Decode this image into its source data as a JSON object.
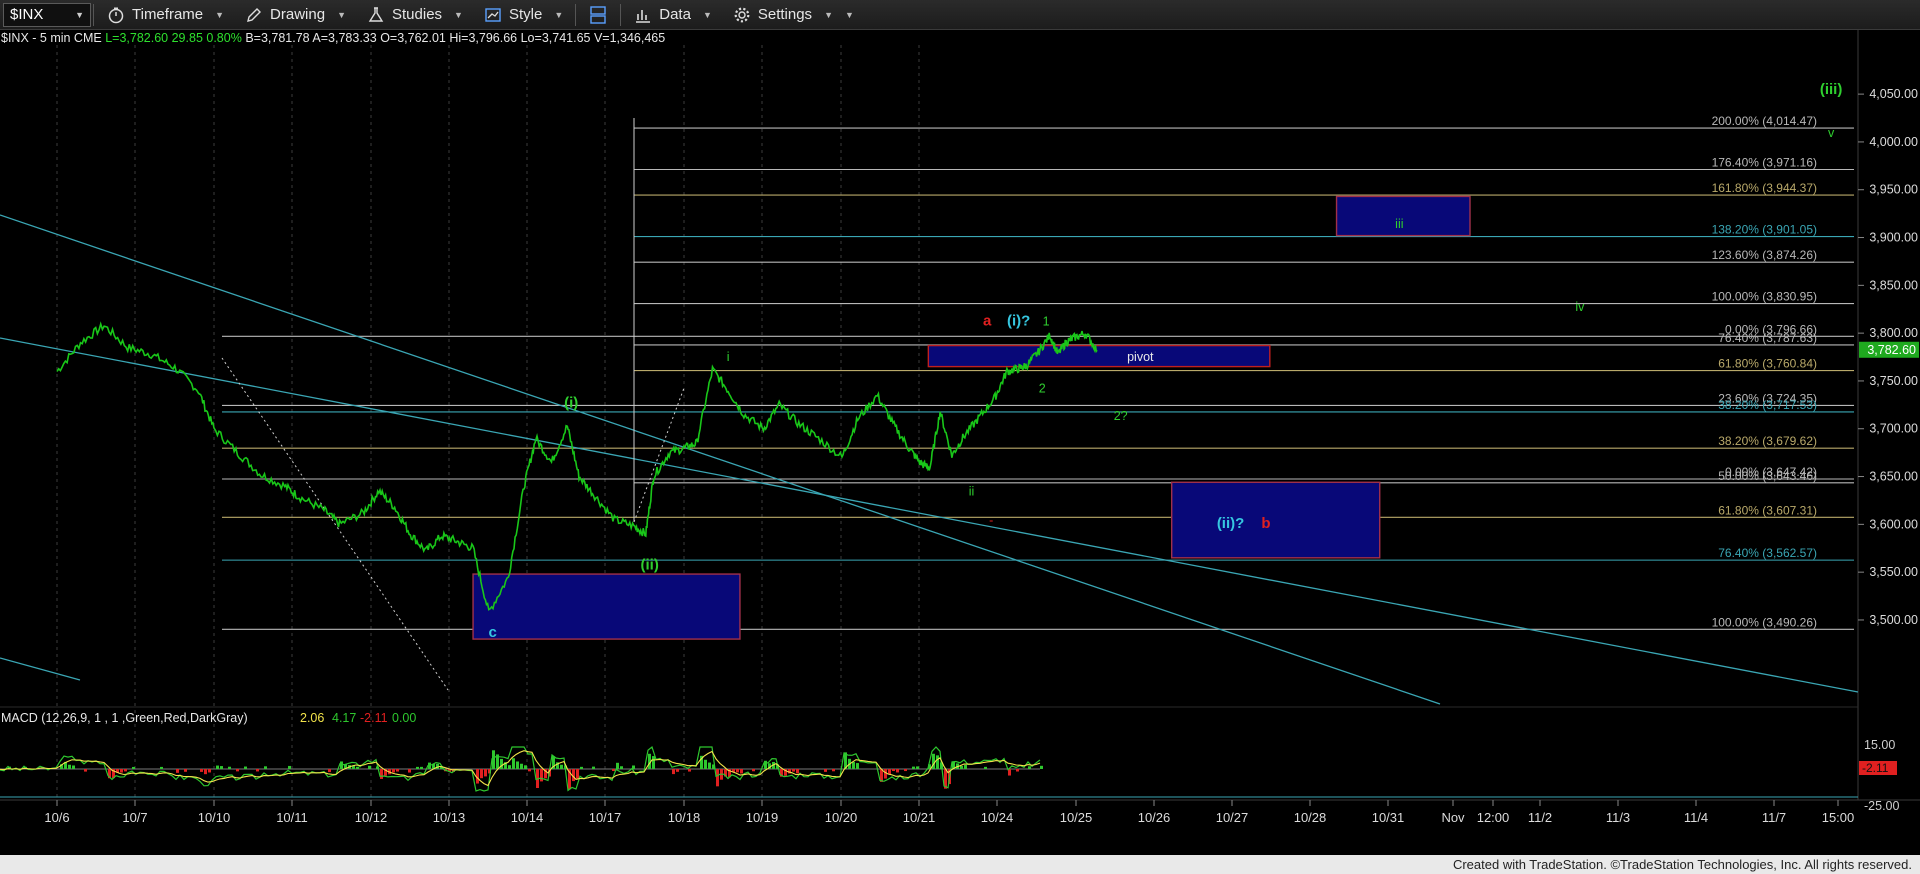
{
  "toolbar": {
    "symbol": "$INX",
    "items": [
      {
        "label": "Timeframe",
        "icon": "stopwatch-icon"
      },
      {
        "label": "Drawing",
        "icon": "pencil-icon"
      },
      {
        "label": "Studies",
        "icon": "flask-icon"
      },
      {
        "label": "Style",
        "icon": "chart-style-icon"
      },
      {
        "label": "",
        "icon": "layout-icon"
      },
      {
        "label": "Data",
        "icon": "bar-chart-icon"
      },
      {
        "label": "Settings",
        "icon": "gear-icon"
      }
    ]
  },
  "info": {
    "name": "$INX - 5 min  CME",
    "last": "L=3,782.60",
    "chg": "29.85",
    "pct": "0.80%",
    "bid": "B=3,781.78",
    "ask": "A=3,783.33",
    "open": "O=3,762.01",
    "high": "Hi=3,796.66",
    "low": "Lo=3,741.65",
    "vol": "V=1,346,465"
  },
  "macd": {
    "label": "MACD (12,26,9, 1 , 1 ,Green,Red,DarkGray)",
    "v1": "2.06",
    "v2": "4.17",
    "v3": "-2.11",
    "v4": "0.00",
    "axis": [
      "15.00",
      "-25.00"
    ],
    "current": "-2.11"
  },
  "footer": "Created with TradeStation. ©TradeStation Technologies, Inc. All rights reserved.",
  "colors": {
    "price": "#19c719",
    "fib": "#b8b8b8",
    "channel": "#3aa6b4",
    "box_fill": "#080878",
    "box_border": "#a0304a",
    "pivot_border": "#c02020",
    "label_green": "#2fcf2f",
    "label_cyan": "#36c7e0",
    "label_red": "#e02020",
    "price_tag": "#1faa1f"
  },
  "chart_data": {
    "type": "line",
    "title": "",
    "xlabel": "",
    "ylabel": "",
    "ylim": [
      3410,
      4070
    ],
    "y_ticks": [
      3500,
      3550,
      3600,
      3650,
      3700,
      3750,
      3800,
      3850,
      3900,
      3950,
      4000,
      4050
    ],
    "y_tick_labels": [
      "3,500.00",
      "3,550.00",
      "3,600.00",
      "3,650.00",
      "3,700.00",
      "3,750.00",
      "3,800.00",
      "3,850.00",
      "3,900.00",
      "3,950.00",
      "4,000.00",
      "4,050.00"
    ],
    "x_ticks": [
      "10/6",
      "10/7",
      "10/10",
      "10/11",
      "10/12",
      "10/13",
      "10/14",
      "10/17",
      "10/18",
      "10/19",
      "10/20",
      "10/21",
      "10/24",
      "10/25",
      "10/26",
      "10/27",
      "10/28",
      "10/31",
      "Nov",
      "12:00",
      "11/2",
      "11/3",
      "11/4",
      "11/7",
      "15:00"
    ],
    "current_price_label": "3,782.60",
    "current_price": 3782.6,
    "series": [
      {
        "points": [
          [
            0,
            3760
          ],
          [
            0.3,
            3790
          ],
          [
            0.6,
            3808
          ],
          [
            0.9,
            3785
          ],
          [
            1.2,
            3778
          ],
          [
            1.5,
            3764
          ],
          [
            1.8,
            3740
          ],
          [
            2.0,
            3700
          ],
          [
            2.3,
            3675
          ],
          [
            2.6,
            3652
          ],
          [
            2.9,
            3640
          ],
          [
            3.1,
            3628
          ],
          [
            3.4,
            3615
          ],
          [
            3.6,
            3600
          ],
          [
            3.9,
            3612
          ],
          [
            4.1,
            3635
          ],
          [
            4.3,
            3618
          ],
          [
            4.5,
            3590
          ],
          [
            4.7,
            3572
          ],
          [
            4.9,
            3588
          ],
          [
            5.1,
            3582
          ],
          [
            5.3,
            3575
          ],
          [
            5.5,
            3508
          ],
          [
            5.75,
            3545
          ],
          [
            5.95,
            3640
          ],
          [
            6.1,
            3690
          ],
          [
            6.3,
            3665
          ],
          [
            6.5,
            3703
          ],
          [
            6.65,
            3650
          ],
          [
            6.85,
            3630
          ],
          [
            7.1,
            3605
          ],
          [
            7.35,
            3598
          ],
          [
            7.5,
            3590
          ],
          [
            7.6,
            3650
          ],
          [
            7.8,
            3675
          ],
          [
            8.0,
            3680
          ],
          [
            8.15,
            3685
          ],
          [
            8.35,
            3762
          ],
          [
            8.55,
            3740
          ],
          [
            8.75,
            3715
          ],
          [
            9.0,
            3700
          ],
          [
            9.2,
            3725
          ],
          [
            9.45,
            3705
          ],
          [
            9.7,
            3690
          ],
          [
            10.0,
            3670
          ],
          [
            10.2,
            3710
          ],
          [
            10.45,
            3735
          ],
          [
            10.65,
            3705
          ],
          [
            10.85,
            3680
          ],
          [
            11.0,
            3664
          ],
          [
            11.12,
            3659
          ],
          [
            11.25,
            3718
          ],
          [
            11.4,
            3672
          ],
          [
            11.55,
            3692
          ],
          [
            11.75,
            3712
          ],
          [
            11.95,
            3733
          ],
          [
            12.1,
            3760
          ],
          [
            12.25,
            3763
          ],
          [
            12.35,
            3766
          ],
          [
            12.5,
            3780
          ],
          [
            12.65,
            3798
          ],
          [
            12.75,
            3778
          ],
          [
            12.85,
            3790
          ],
          [
            12.95,
            3795
          ],
          [
            13.1,
            3800
          ],
          [
            13.25,
            3782
          ]
        ]
      }
    ],
    "fib_levels": [
      {
        "label": "200.00% (4,014.47)",
        "value": 4014.47
      },
      {
        "label": "176.40% (3,971.16)",
        "value": 3971.16
      },
      {
        "label": "161.80% (3,944.37)",
        "value": 3944.37
      },
      {
        "label": "138.20% (3,901.05)",
        "value": 3901.05
      },
      {
        "label": "123.60% (3,874.26)",
        "value": 3874.26
      },
      {
        "label": "100.00% (3,830.95)",
        "value": 3830.95
      },
      {
        "label": "0.00% (3,796.66)",
        "value": 3796.66
      },
      {
        "label": "76.40% (3,787.63)",
        "value": 3787.63
      },
      {
        "label": "61.80% (3,760.84)",
        "value": 3760.84
      },
      {
        "label": "23.60% (3,724.35)",
        "value": 3724.35
      },
      {
        "label": "38.20% (3,717.53)",
        "value": 3717.53
      },
      {
        "label": "38.20% (3,679.62)",
        "value": 3679.62
      },
      {
        "label": "0.00% (3,647.42)",
        "value": 3647.42
      },
      {
        "label": "50.00% (3,643.46)",
        "value": 3643.46
      },
      {
        "label": "61.80% (3,607.31)",
        "value": 3607.31
      },
      {
        "label": "76.40% (3,562.57)",
        "value": 3562.57
      },
      {
        "label": "100.00% (3,490.26)",
        "value": 3490.26
      }
    ],
    "annotations": [
      {
        "text": "(iii)",
        "t": 22.6,
        "y": 4050,
        "color": "green"
      },
      {
        "text": "v",
        "t": 22.6,
        "y": 4005,
        "color": "green"
      },
      {
        "text": "iii",
        "t": 17.1,
        "y": 3910,
        "color": "green"
      },
      {
        "text": "iv",
        "t": 19.4,
        "y": 3823,
        "color": "green"
      },
      {
        "text": "a",
        "t": 11.85,
        "y": 3808,
        "color": "red"
      },
      {
        "text": "(i)?",
        "t": 12.25,
        "y": 3808,
        "color": "cyan"
      },
      {
        "text": "1",
        "t": 12.6,
        "y": 3808,
        "color": "green"
      },
      {
        "text": "pivot",
        "t": 13.8,
        "y": 3771,
        "color": "white"
      },
      {
        "text": "i",
        "t": 8.55,
        "y": 3771,
        "color": "green"
      },
      {
        "text": "2",
        "t": 12.55,
        "y": 3738,
        "color": "green"
      },
      {
        "text": "2?",
        "t": 13.55,
        "y": 3709,
        "color": "green"
      },
      {
        "text": "(i)",
        "t": 6.55,
        "y": 3722,
        "color": "green"
      },
      {
        "text": "ii",
        "t": 11.65,
        "y": 3630,
        "color": "green"
      },
      {
        "text": "-",
        "t": 11.9,
        "y": 3600,
        "color": "red"
      },
      {
        "text": "(ii)?",
        "t": 14.95,
        "y": 3596,
        "color": "cyan"
      },
      {
        "text": "b",
        "t": 15.4,
        "y": 3596,
        "color": "red"
      },
      {
        "text": "(ii)",
        "t": 7.55,
        "y": 3553,
        "color": "green"
      },
      {
        "text": "c",
        "t": 5.55,
        "y": 3482,
        "color": "cyan"
      }
    ],
    "boxes": [
      {
        "t0": 16.3,
        "t1": 18.0,
        "y0": 3902,
        "y1": 3943,
        "label_ref": "iii"
      },
      {
        "t0": 11.1,
        "t1": 15.45,
        "y0": 3765,
        "y1": 3787,
        "label_ref": "pivot",
        "border": "red"
      },
      {
        "t0": 14.2,
        "t1": 16.85,
        "y0": 3565,
        "y1": 3644,
        "label_ref": "(ii)?"
      },
      {
        "t0": 5.3,
        "t1": 8.7,
        "y0": 3480,
        "y1": 3548,
        "label_ref": "c"
      }
    ]
  }
}
